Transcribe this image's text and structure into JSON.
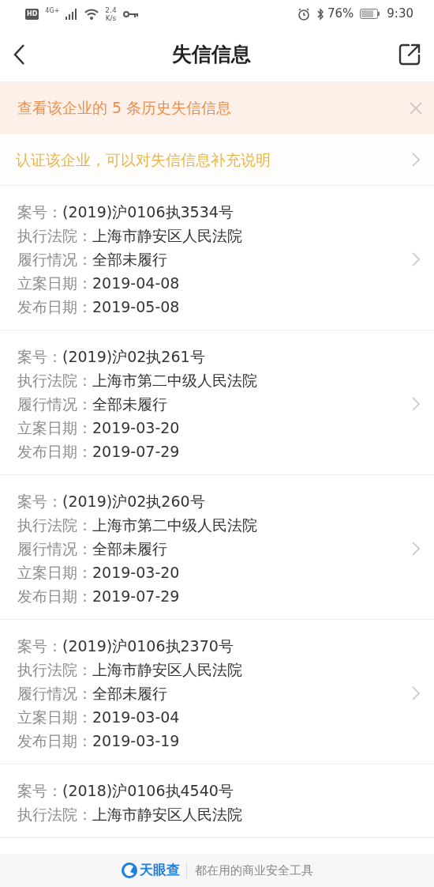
{
  "status_bar": {
    "hd": "HD",
    "network": "4G+",
    "speed_value": "2.4",
    "speed_unit": "K/s",
    "battery_percent": "76%",
    "time": "9:30"
  },
  "header": {
    "title": "失信信息"
  },
  "notice": {
    "text": "查看该企业的 5 条历史失信信息"
  },
  "prompt": {
    "text": "认证该企业，可以对失信信息补充说明"
  },
  "records": [
    {
      "fields": [
        {
          "label": "案号：",
          "value": "(2019)沪0106执3534号"
        },
        {
          "label": "执行法院：",
          "value": "上海市静安区人民法院"
        },
        {
          "label": "履行情况：",
          "value": "全部未履行"
        },
        {
          "label": "立案日期：",
          "value": "2019-04-08"
        },
        {
          "label": "发布日期：",
          "value": "2019-05-08"
        }
      ]
    },
    {
      "fields": [
        {
          "label": "案号：",
          "value": "(2019)沪02执261号"
        },
        {
          "label": "执行法院：",
          "value": "上海市第二中级人民法院"
        },
        {
          "label": "履行情况：",
          "value": "全部未履行"
        },
        {
          "label": "立案日期：",
          "value": "2019-03-20"
        },
        {
          "label": "发布日期：",
          "value": "2019-07-29"
        }
      ]
    },
    {
      "fields": [
        {
          "label": "案号：",
          "value": "(2019)沪02执260号"
        },
        {
          "label": "执行法院：",
          "value": "上海市第二中级人民法院"
        },
        {
          "label": "履行情况：",
          "value": "全部未履行"
        },
        {
          "label": "立案日期：",
          "value": "2019-03-20"
        },
        {
          "label": "发布日期：",
          "value": "2019-07-29"
        }
      ]
    },
    {
      "fields": [
        {
          "label": "案号：",
          "value": "(2019)沪0106执2370号"
        },
        {
          "label": "执行法院：",
          "value": "上海市静安区人民法院"
        },
        {
          "label": "履行情况：",
          "value": "全部未履行"
        },
        {
          "label": "立案日期：",
          "value": "2019-03-04"
        },
        {
          "label": "发布日期：",
          "value": "2019-03-19"
        }
      ]
    },
    {
      "fields": [
        {
          "label": "案号：",
          "value": "(2018)沪0106执4540号"
        },
        {
          "label": "执行法院：",
          "value": "上海市静安区人民法院"
        }
      ]
    }
  ],
  "footer": {
    "brand": "天眼查",
    "slogan": "都在用的商业安全工具"
  }
}
